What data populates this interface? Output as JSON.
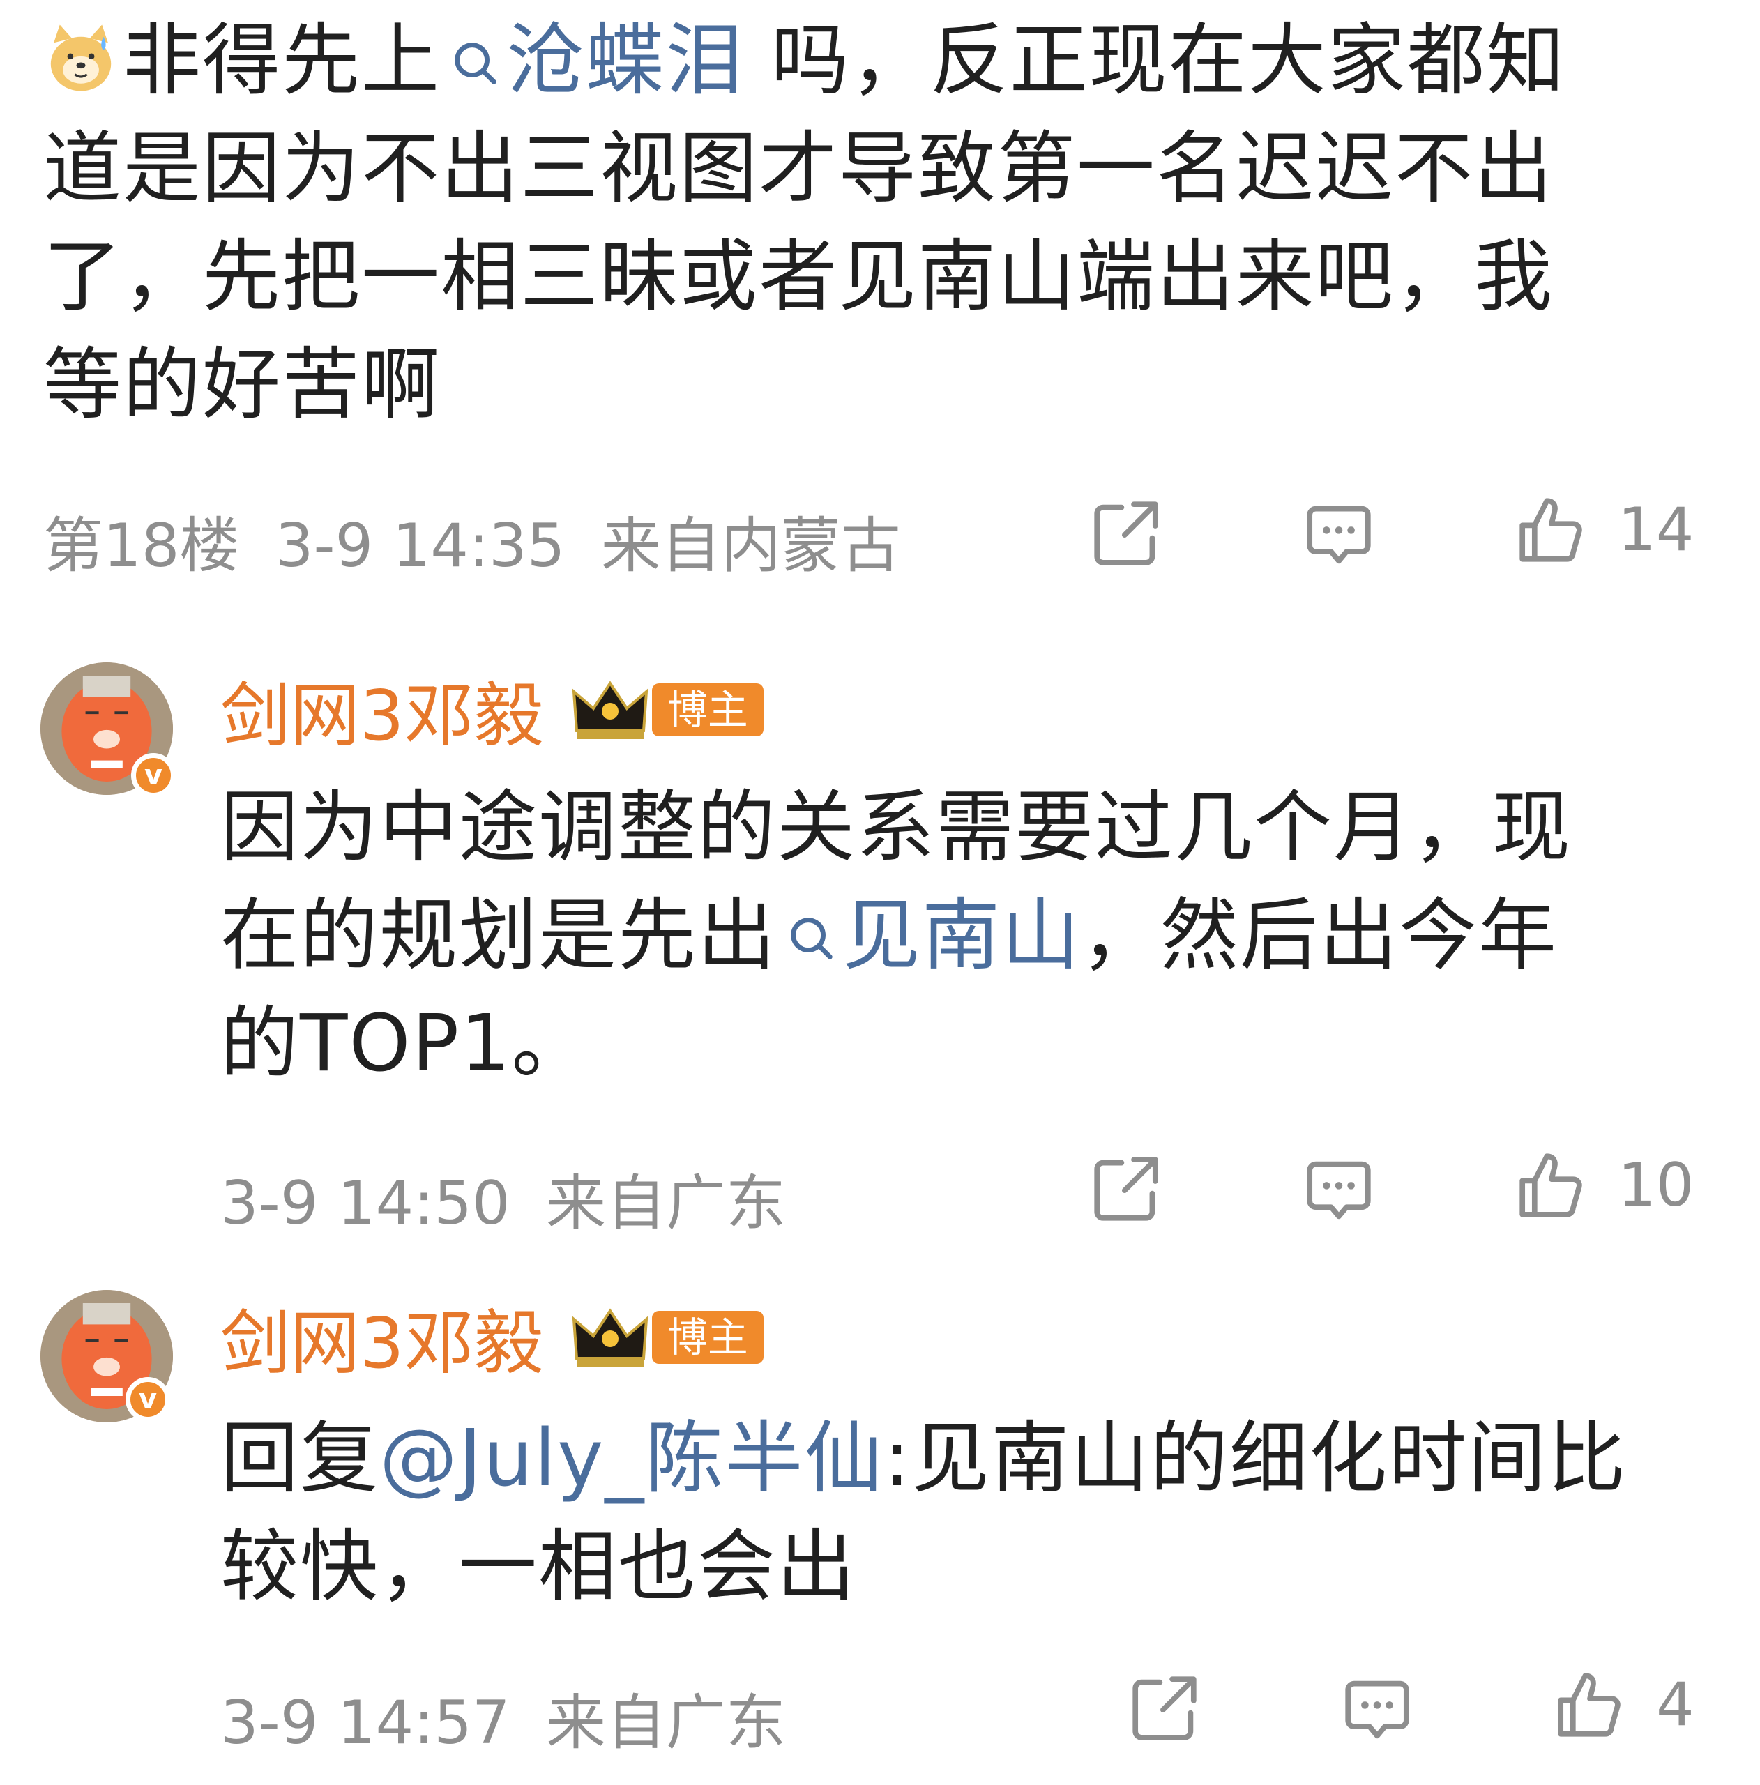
{
  "comment": {
    "emoji": "dog-sweat-emoji",
    "text_before_link": "非得先上",
    "link": "沧蝶泪",
    "text_line1_after": " 吗，反正现在大家都知",
    "text_line2": "道是因为不出三视图才导致第一名迟迟不出",
    "text_line3": "了，先把一相三昧或者见南山端出来吧，我",
    "text_line4": "等的好苦啊",
    "floor": "第18楼",
    "time": "3-9 14:35",
    "location": "来自内蒙古",
    "likes": "14"
  },
  "replies": [
    {
      "username": "剑网3邓毅",
      "tag": "博主",
      "line1": "因为中途调整的关系需要过几个月，现",
      "line2_before": "在的规划是先出",
      "line2_link": "见南山",
      "line2_after": "，然后出今年",
      "line3": "的TOP1。",
      "time": "3-9 14:50",
      "location": "来自广东",
      "likes": "10"
    },
    {
      "username": "剑网3邓毅",
      "tag": "博主",
      "line1_prefix": "回复",
      "line1_mention": "@July_陈半仙",
      "line1_after": ":见南山的细化时间比",
      "line2": "较快，一相也会出",
      "time": "3-9 14:57",
      "location": "来自广东",
      "likes": "4"
    }
  ],
  "icons": {
    "share": "share-icon",
    "comment": "comment-icon",
    "like": "like-icon",
    "search": "search-icon",
    "crown": "crown-icon",
    "verified": "verified-badge-icon"
  },
  "colors": {
    "link": "#4a6d9c",
    "username": "#e6782b",
    "meta": "#8e8e8e",
    "tag_bg": "#f08a2b"
  }
}
